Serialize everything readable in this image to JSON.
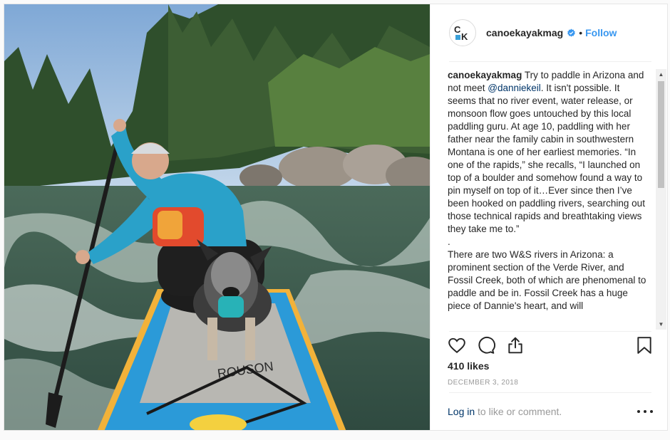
{
  "post": {
    "username": "canoekayakmag",
    "follow_label": "Follow",
    "separator": "•",
    "avatar_text": "CK",
    "caption_user": "canoekayakmag",
    "caption_pre": " Try to paddle in Arizona and not meet ",
    "caption_mention": "@danniekeil",
    "caption_post": ". It isn't possible. It seems that no river event, water release, or monsoon flow goes untouched by this local paddling guru. At age 10, paddling with her father near the family cabin in southwestern Montana is one of her earliest memories. “In one of the rapids,” she recalls, “I launched on top of a boulder and somehow found a way to pin myself on top of it…Ever since then I’ve been hooked on paddling rivers, searching out those technical rapids and breathtaking views they take me to.”\n.\nThere are two W&S rivers in Arizona: a prominent section of the Verde River, and Fossil Creek, both of which are phenomenal to paddle and be in. Fossil Creek has a huge piece of Dannie's heart, and will",
    "likes": "410 likes",
    "date": "December 3, 2018",
    "login_link": "Log in",
    "login_rest": " to like or comment.",
    "board_brand": "ROUSON"
  },
  "icons": {
    "like": "heart-icon",
    "comment": "comment-bubble-icon",
    "share": "share-icon",
    "save": "bookmark-icon",
    "verified": "verified-badge-icon",
    "more": "more-options-icon"
  },
  "colors": {
    "accent": "#3897f0",
    "verified": "#3897f0",
    "link": "#003569",
    "muted": "#999999",
    "text": "#262626"
  }
}
